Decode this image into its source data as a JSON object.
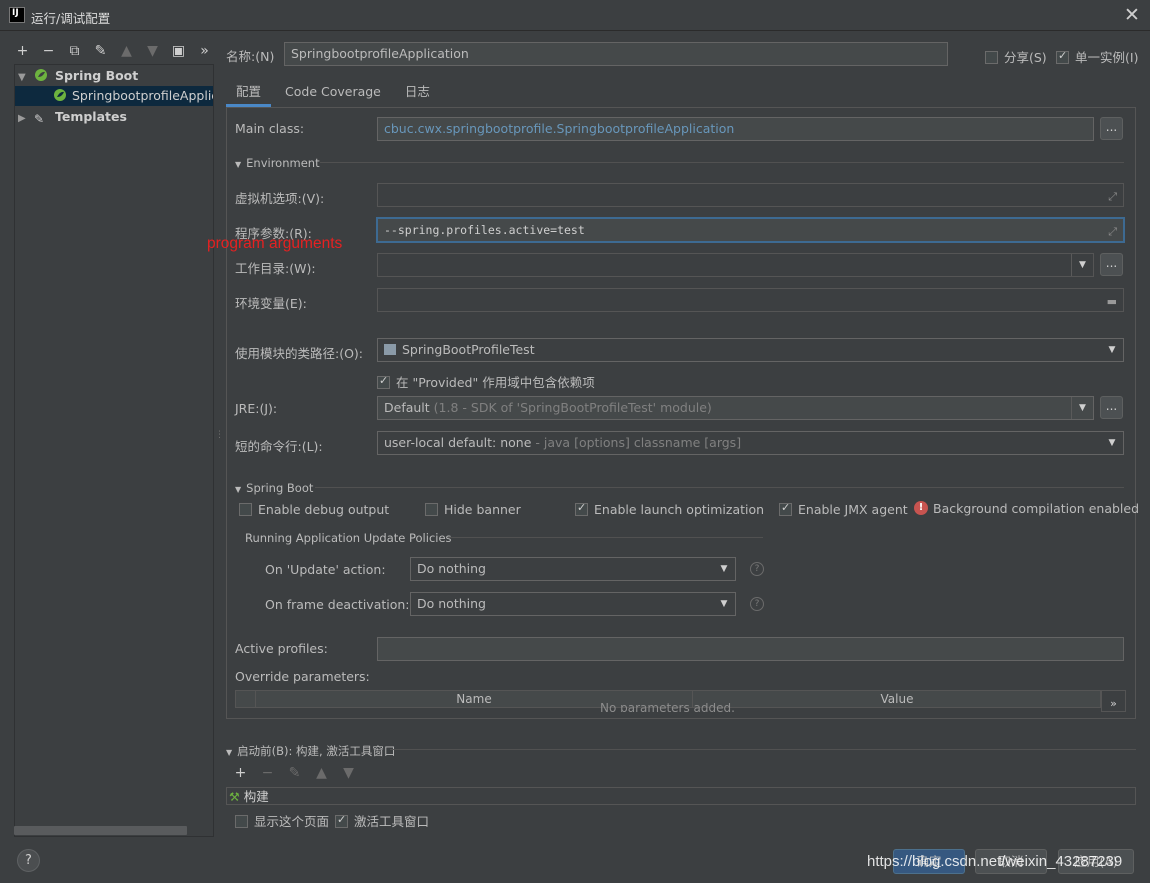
{
  "window": {
    "icon_text": "IJ",
    "title": "运行/调试配置"
  },
  "toolbar": {
    "add": "+",
    "remove": "−",
    "copy": "⧉",
    "edit": "✎",
    "up": "▲",
    "down": "▼",
    "folder": "▣",
    "more": "»"
  },
  "tree": {
    "spring_boot": "Spring Boot",
    "app": "SpringbootprofileApplication",
    "templates": "Templates"
  },
  "name": {
    "label": "名称:(N)",
    "value": "SpringbootprofileApplication"
  },
  "share": {
    "label": "分享(S)",
    "checked": false
  },
  "single_instance": {
    "label": "单一实例(I)",
    "checked": true
  },
  "tabs": [
    "配置",
    "Code Coverage",
    "日志"
  ],
  "config": {
    "main_class_label": "Main class:",
    "main_class_value": "cbuc.cwx.springbootprofile.SpringbootprofileApplication",
    "environment_header": "Environment",
    "vm_options_label": "虚拟机选项:(V):",
    "vm_options_value": "",
    "program_args_label": "程序参数:(R):",
    "program_args_value": "--spring.profiles.active=test",
    "annotation": "program arguments",
    "working_dir_label": "工作目录:(W):",
    "working_dir_value": "",
    "env_vars_label": "环境变量(E):",
    "env_vars_value": "",
    "module_label": "使用模块的类路径:(O):",
    "module_value": "SpringBootProfileTest",
    "provided_label": "在 \"Provided\" 作用域中包含依赖项",
    "provided_checked": true,
    "jre_label": "JRE:(J):",
    "jre_value": "Default",
    "jre_detail": "(1.8 - SDK of 'SpringBootProfileTest' module)",
    "shorten_label": "短的命令行:(L):",
    "shorten_value": "user-local default: none",
    "shorten_detail": "- java [options] classname [args]"
  },
  "spring_boot": {
    "header": "Spring Boot",
    "debug_output": {
      "label": "Enable debug output",
      "checked": false
    },
    "hide_banner": {
      "label": "Hide banner",
      "checked": false
    },
    "launch_opt": {
      "label": "Enable launch optimization",
      "checked": true
    },
    "jmx_agent": {
      "label": "Enable JMX agent",
      "checked": true
    },
    "bg_compile": "Background compilation enabled",
    "update_policies_header": "Running Application Update Policies",
    "on_update_label": "On 'Update' action:",
    "on_update_value": "Do nothing",
    "on_frame_label": "On frame deactivation:",
    "on_frame_value": "Do nothing",
    "active_profiles_label": "Active profiles:",
    "active_profiles_value": "",
    "override_label": "Override parameters:",
    "col_name": "Name",
    "col_value": "Value",
    "empty_text": "No parameters added.",
    "expand": "»"
  },
  "before_launch": {
    "header": "启动前(B): 构建, 激活工具窗口",
    "add": "+",
    "remove": "−",
    "edit": "✎",
    "up": "▲",
    "down": "▼",
    "item": "构建",
    "show_page": {
      "label": "显示这个页面",
      "checked": false
    },
    "activate_tool": {
      "label": "激活工具窗口",
      "checked": true
    }
  },
  "buttons": {
    "ok": "确定",
    "cancel": "取消",
    "apply": "应用(A)",
    "help": "?"
  },
  "watermark": "https://blog.csdn.net/weixin_43287239",
  "colors": {
    "background": "#3c3f41",
    "selection": "#0d293e",
    "accent": "#4a88c7",
    "annotation": "#e52121",
    "link": "#6897bb"
  }
}
